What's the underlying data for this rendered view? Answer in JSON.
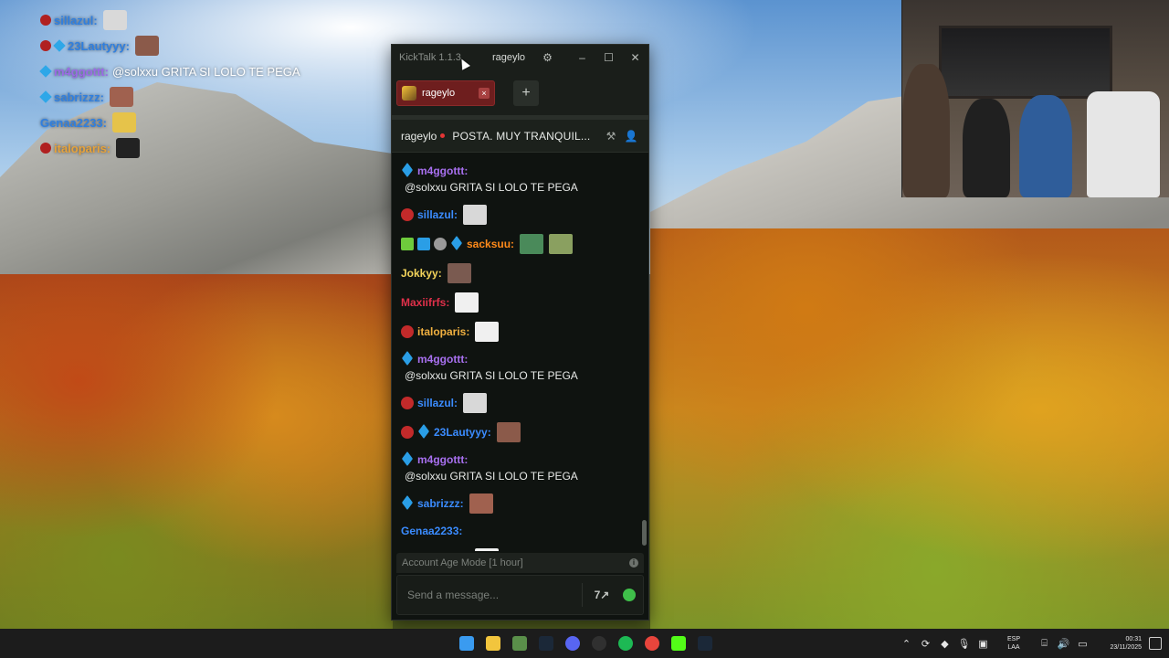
{
  "overlay": {
    "lines": [
      {
        "user": "sillazul:",
        "color": "#2f7fe0",
        "badges": [
          "circle"
        ],
        "msg": "",
        "emote": "#d9d9d9"
      },
      {
        "user": "23Lautyyy:",
        "color": "#2f7fe0",
        "badges": [
          "circle",
          "cube"
        ],
        "msg": "",
        "emote": "#8b5a4a"
      },
      {
        "user": "m4ggottt:",
        "color": "#9b6ae6",
        "badges": [
          "cube"
        ],
        "msg": "@solxxu GRITA SI LOLO TE PEGA",
        "emote": ""
      },
      {
        "user": "sabrizzz:",
        "color": "#2f7fe0",
        "badges": [
          "cube"
        ],
        "msg": "",
        "emote": "#a0614f"
      },
      {
        "user": "Genaa2233:",
        "color": "#2f7fe0",
        "badges": [],
        "msg": "",
        "emote": "#e6c34a"
      },
      {
        "user": "italoparis:",
        "color": "#e6a23a",
        "badges": [
          "circle"
        ],
        "msg": "",
        "emote": "#222222"
      }
    ]
  },
  "kicktalk": {
    "app_name": "KickTalk 1.1.3",
    "title_user": "rageylo",
    "tab_label": "rageylo",
    "tab_close": "×",
    "add_tab": "+",
    "channel": "rageylo",
    "stream_title": "POSTA. MUY TRANQUIL...",
    "mode_label": "Account Age Mode [1 hour]",
    "mode_info": "i",
    "input_placeholder": "Send a message...",
    "translate_icon": "7↗"
  },
  "chat": [
    {
      "user": "m4ggottt:",
      "color": "#a870f0",
      "badges": [
        "cube"
      ],
      "text": "@solxxu GRITA SI LOLO TE PEGA",
      "emote": ""
    },
    {
      "user": "sillazul:",
      "color": "#3b8cff",
      "badges": [
        "circle-red"
      ],
      "text": "",
      "emote": "#d8d8d8"
    },
    {
      "user": "sacksuu:",
      "color": "#ff8a1a",
      "badges": [
        "square-green",
        "square-blue",
        "circle-grey",
        "cube"
      ],
      "text": "",
      "emote": "#4a8a5a",
      "emote2": "#8aa060"
    },
    {
      "user": "Jokkyy:",
      "color": "#f2d35a",
      "badges": [],
      "text": "",
      "emote": "#7a5a50"
    },
    {
      "user": "Maxiifrfs:",
      "color": "#e0304a",
      "badges": [],
      "text": "",
      "emote": "#f0f0f0"
    },
    {
      "user": "italoparis:",
      "color": "#f0b040",
      "badges": [
        "circle-red"
      ],
      "text": "",
      "emote": "#f0f0f0"
    },
    {
      "user": "m4ggottt:",
      "color": "#a870f0",
      "badges": [
        "cube"
      ],
      "text": "@solxxu GRITA SI LOLO TE PEGA",
      "emote": ""
    },
    {
      "user": "sillazul:",
      "color": "#3b8cff",
      "badges": [
        "circle-red"
      ],
      "text": "",
      "emote": "#d8d8d8"
    },
    {
      "user": "23Lautyyy:",
      "color": "#3b8cff",
      "badges": [
        "circle-red",
        "cube"
      ],
      "text": "",
      "emote": "#8b5a4a"
    },
    {
      "user": "m4ggottt:",
      "color": "#a870f0",
      "badges": [
        "cube"
      ],
      "text": "@solxxu GRITA SI LOLO TE PEGA",
      "emote": ""
    },
    {
      "user": "sabrizzz:",
      "color": "#3b8cff",
      "badges": [
        "cube"
      ],
      "text": "",
      "emote": "#a0614f"
    },
    {
      "user": "Genaa2233:",
      "color": "#3b8cff",
      "badges": [],
      "text": "",
      "emote": ""
    },
    {
      "user": "italoparis:",
      "color": "#f0b040",
      "badges": [
        "circle-red"
      ],
      "text": "",
      "emote": "#f0f0f0"
    }
  ],
  "taskbar": {
    "apps": [
      "windows-start-icon",
      "file-explorer-icon",
      "game-icon",
      "steam-icon",
      "discord-icon",
      "obs-icon",
      "spotify-icon",
      "chrome-icon",
      "kick-icon",
      "steam-icon-2"
    ],
    "lang_top": "ESP",
    "lang_bottom": "LAA",
    "time": "00:31",
    "date": "23/11/2025"
  }
}
